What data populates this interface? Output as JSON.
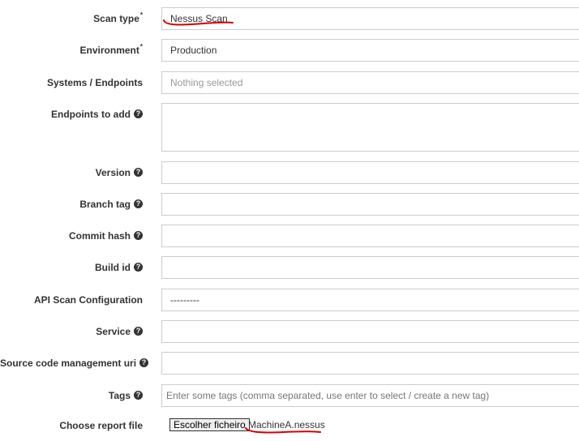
{
  "form": {
    "scan_type": {
      "label": "Scan type",
      "required": "*",
      "value": "Nessus Scan"
    },
    "environment": {
      "label": "Environment",
      "required": "*",
      "value": "Production"
    },
    "systems_endpoints": {
      "label": "Systems / Endpoints",
      "placeholder": "Nothing selected"
    },
    "endpoints_to_add": {
      "label": "Endpoints to add"
    },
    "version": {
      "label": "Version"
    },
    "branch_tag": {
      "label": "Branch tag"
    },
    "commit_hash": {
      "label": "Commit hash"
    },
    "build_id": {
      "label": "Build id"
    },
    "api_scan_configuration": {
      "label": "API Scan Configuration",
      "value": "---------"
    },
    "service": {
      "label": "Service"
    },
    "source_code_management_uri": {
      "label": "Source code management uri"
    },
    "tags": {
      "label": "Tags",
      "placeholder": "Enter some tags (comma separated, use enter to select / create a new tag)"
    },
    "report_file": {
      "label": "Choose report file",
      "button_label": "Escolher ficheiro",
      "file_name": "MachineA.nessus"
    }
  },
  "help_glyph": "?",
  "icons": {
    "help": "question-circle-icon"
  },
  "colors": {
    "annotation": "#d40000",
    "border": "#cccccc",
    "label": "#333333",
    "placeholder": "#999999"
  }
}
